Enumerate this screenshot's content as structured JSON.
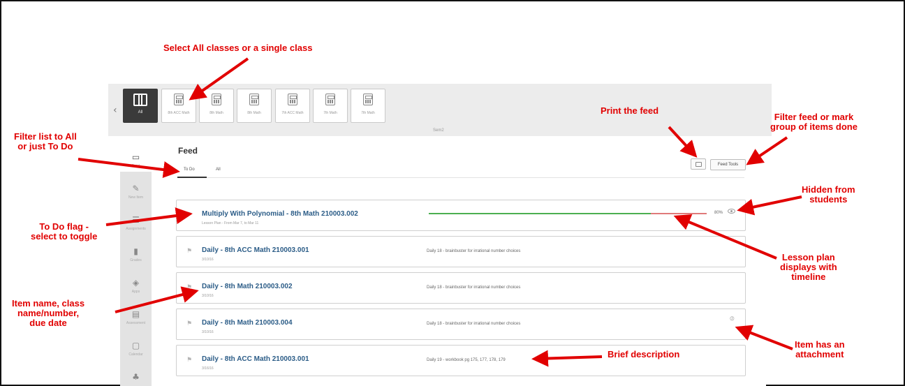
{
  "class_bar": {
    "tiles": [
      {
        "label": "All",
        "active": true,
        "icon": "book-icon"
      },
      {
        "label": "8th ACC Math",
        "icon": "calculator-icon"
      },
      {
        "label": "8th Math",
        "icon": "calculator-icon"
      },
      {
        "label": "8th Math",
        "icon": "calculator-icon"
      },
      {
        "label": "7th ACC Math",
        "icon": "calculator-icon"
      },
      {
        "label": "7th Math",
        "icon": "calculator-icon"
      },
      {
        "label": "7th Math",
        "icon": "calculator-icon"
      }
    ],
    "term": "Sem2"
  },
  "sidebar": {
    "items": [
      {
        "label": "Feed",
        "icon": "inbox-icon",
        "active": true
      },
      {
        "label": "New Item",
        "icon": "edit-icon"
      },
      {
        "label": "Assignments",
        "icon": "list-icon"
      },
      {
        "label": "Grades",
        "icon": "bar-chart-icon"
      },
      {
        "label": "Apps",
        "icon": "cube-icon"
      },
      {
        "label": "Assessment",
        "icon": "assessment-icon"
      },
      {
        "label": "Calendar",
        "icon": "calendar-icon"
      },
      {
        "label": "",
        "icon": "sitemap-icon"
      }
    ]
  },
  "feed": {
    "title": "Feed",
    "tabs": [
      "To Do",
      "All"
    ],
    "tools_label": "Feed Tools",
    "print_icon": "print-icon"
  },
  "items": [
    {
      "name": "Multiply With Polynomial - 8th Math 210003.002",
      "sub": "Lesson Plan - From Mar 7, to Mar 11",
      "progress": 80,
      "progress_label": "80%",
      "hidden": true
    },
    {
      "name": "Daily - 8th ACC Math 210003.001",
      "sub": "3/10/16",
      "desc": "Daily 18 - brainbuster for irrational number choices"
    },
    {
      "name": "Daily - 8th Math 210003.002",
      "sub": "3/10/16",
      "desc": "Daily 18 - brainbuster for irrational number choices"
    },
    {
      "name": "Daily - 8th Math 210003.004",
      "sub": "3/10/16",
      "desc": "Daily 18 - brainbuster for irrational number choices",
      "attachment": true
    },
    {
      "name": "Daily - 8th ACC Math 210003.001",
      "sub": "3/16/16",
      "desc": "Daily 19 - workbook pg 175, 177, 178, 179"
    }
  ],
  "annotations": {
    "select_classes": "Select All classes or a single class",
    "filter_list": "Filter list to All\nor just To Do",
    "print_feed": "Print the feed",
    "filter_feed": "Filter feed or mark\ngroup of items done",
    "hidden": "Hidden from\nstudents",
    "todo_flag": "To Do flag -\nselect to toggle",
    "lesson_plan": "Lesson plan\ndisplays with\ntimeline",
    "item_name": "Item name, class\nname/number,\ndue date",
    "attachment": "Item has an\nattachment",
    "brief_desc": "Brief description"
  },
  "colors": {
    "annotation": "#e10000",
    "link": "#2b5c87",
    "progress": "#4caf50",
    "overdue": "#e07a7a"
  }
}
